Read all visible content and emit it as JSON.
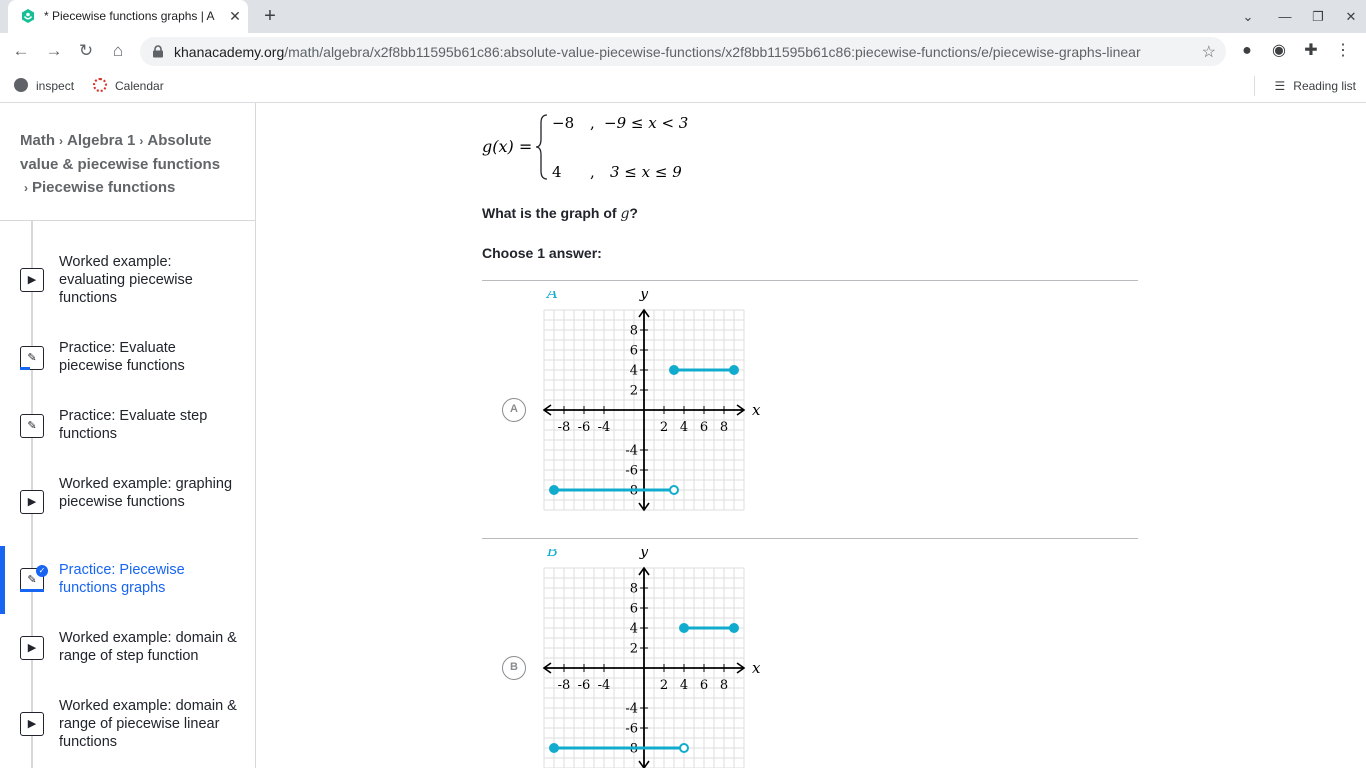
{
  "browser": {
    "tab_title": "* Piecewise functions graphs | A",
    "url_host": "khanacademy.org",
    "url_path": "/math/algebra/x2f8bb11595b61c86:absolute-value-piecewise-functions/x2f8bb11595b61c86:piecewise-functions/e/piecewise-graphs-linear",
    "bookmarks": [
      "inspect",
      "Calendar"
    ],
    "reading_list": "Reading list"
  },
  "sidebar": {
    "breadcrumb": [
      "Math",
      "Algebra 1",
      "Absolute value & piecewise functions",
      "Piecewise functions"
    ],
    "items": [
      {
        "type": "video",
        "label": "Worked example: evaluating piecewise functions"
      },
      {
        "type": "exercise",
        "label": "Practice: Evaluate piecewise functions"
      },
      {
        "type": "exercise",
        "label": "Practice: Evaluate step functions"
      },
      {
        "type": "video",
        "label": "Worked example: graphing piecewise functions"
      },
      {
        "type": "exercise",
        "label": "Practice: Piecewise functions graphs",
        "active": true
      },
      {
        "type": "video",
        "label": "Worked example: domain & range of step function"
      },
      {
        "type": "video",
        "label": "Worked example: domain & range of piecewise linear functions"
      }
    ]
  },
  "problem": {
    "lhs": "g(x) =",
    "cases": [
      {
        "value": "−8",
        "condition": "−9 ≤ x < 3"
      },
      {
        "value": "4",
        "condition": "3 ≤ x ≤ 9"
      }
    ],
    "question_prefix": "What is the graph of",
    "question_var": "g",
    "question_suffix": "?",
    "choose_label": "Choose 1 answer:"
  },
  "choices": [
    {
      "letter": "A",
      "graph_label": "A",
      "segments": [
        {
          "x1": 3,
          "x2": 9,
          "y": 4,
          "left": "closed",
          "right": "closed"
        },
        {
          "x1": -9,
          "x2": 3,
          "y": -8,
          "left": "closed",
          "right": "open"
        }
      ]
    },
    {
      "letter": "B",
      "graph_label": "B",
      "segments": [
        {
          "x1": 4,
          "x2": 9,
          "y": 4,
          "left": "closed",
          "right": "closed"
        },
        {
          "x1": -9,
          "x2": 4,
          "y": -8,
          "left": "closed",
          "right": "open"
        }
      ]
    }
  ],
  "axes": {
    "xlabel": "x",
    "ylabel": "y",
    "xlim": [
      -10,
      10
    ],
    "ylim": [
      -10,
      10
    ],
    "x_ticks": [
      "-8",
      "-6",
      "-4",
      "2",
      "4",
      "6",
      "8"
    ],
    "y_ticks": [
      "8",
      "6",
      "4",
      "2",
      "-4",
      "-6",
      "-8"
    ]
  },
  "colors": {
    "accent": "#1fab54",
    "graph_line": "#11accd",
    "link": "#1865f2",
    "grid": "#dddddd"
  }
}
